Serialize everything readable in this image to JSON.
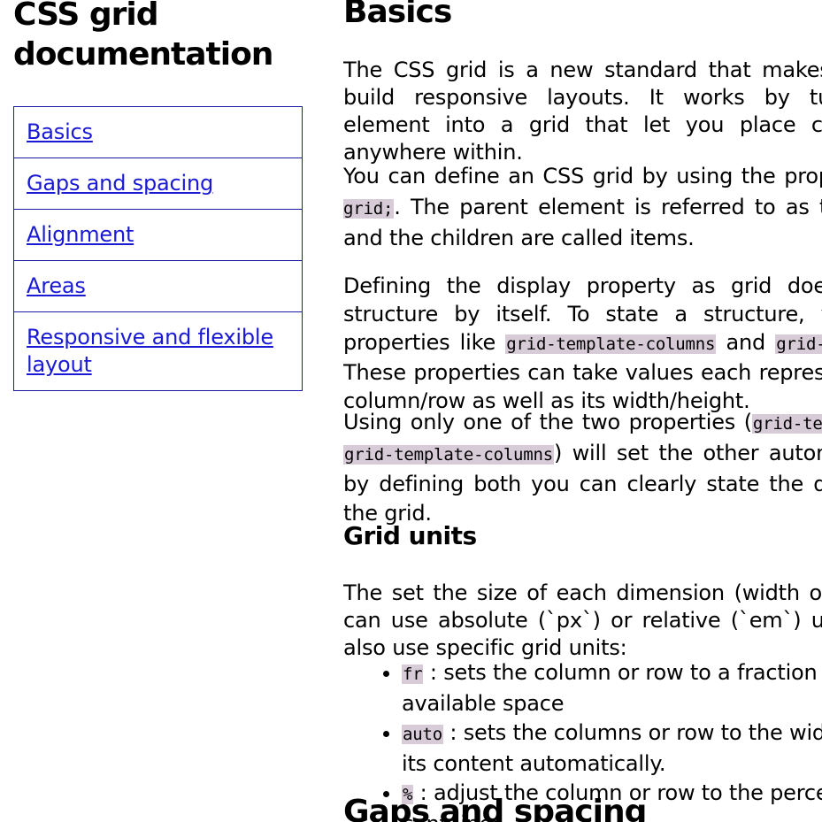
{
  "nav": {
    "title": "CSS grid documentation",
    "items": [
      {
        "label": "Basics"
      },
      {
        "label": "Gaps and spacing"
      },
      {
        "label": "Alignment"
      },
      {
        "label": "Areas"
      },
      {
        "label": "Responsive and flexible layout"
      }
    ]
  },
  "main": {
    "basics_heading": "Basics",
    "p1": "The CSS grid is a new standard that makes it easier to build responsive layouts. It works by turning HTML element into a grid that let you place child element anywhere within.",
    "p2": {
      "a": "You can define an CSS grid by using the property ",
      "code": "display: grid;",
      "b": ". The parent element is referred to as the container and the children are called items."
    },
    "p3": {
      "a": "Defining the display property as grid doesn't show a structure by itself. To state a structure, you use the properties like ",
      "code1": "grid-template-columns",
      "b": " and ",
      "code2": "grid-template-rows",
      "c": ". These properties can take values each representing a new column/row as well as its width/height."
    },
    "p4": {
      "a": "Using only one of the two properties (",
      "code1": "grid-template-rows",
      "b": " or ",
      "code2": "grid-template-columns",
      "c": ") will set the other automatically, but by defining both you can clearly state the dimensions of the grid."
    },
    "units_heading": "Grid units",
    "p5": "The set the size of each dimension (width or height) you can use absolute (`px`) or relative (`em`) units. You can also use specific grid units:",
    "units": [
      {
        "code": "fr",
        "text": " : sets the column or row to a fraction of the available space"
      },
      {
        "code": "auto",
        "text": " : sets the columns or row to the width/height of its content automatically."
      },
      {
        "code": "%",
        "text": " : adjust the column or row to the percentage of the container"
      }
    ],
    "gaps_heading": "Gaps and spacing"
  }
}
